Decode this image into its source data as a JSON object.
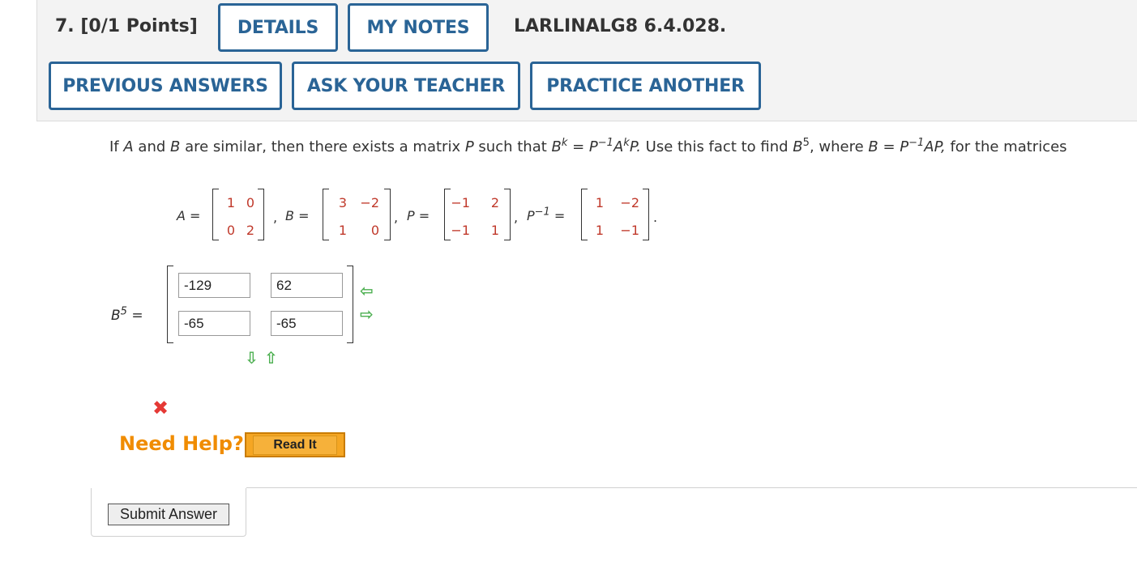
{
  "header": {
    "question_number": "7.",
    "points": "[0/1 Points]",
    "details_label": "DETAILS",
    "my_notes_label": "MY NOTES",
    "question_code": "LARLINALG8 6.4.028.",
    "previous_answers_label": "PREVIOUS ANSWERS",
    "ask_teacher_label": "ASK YOUR TEACHER",
    "practice_another_label": "PRACTICE ANOTHER"
  },
  "question": {
    "t1": "If ",
    "A": "A",
    "t2": " and ",
    "B": "B",
    "t3": " are similar, then there exists a matrix ",
    "P": "P",
    "t4": " such that ",
    "eq1": "B",
    "eq1_sup": "k",
    "eq1_rest": " = P",
    "eq1_sup2": "−1",
    "eq1_rest2": "A",
    "eq1_sup3": "k",
    "eq1_rest3": "P.",
    "t5": " Use this fact to find ",
    "b5": "B",
    "b5_sup": "5",
    "t6": ", where ",
    "eq2": "B = P",
    "eq2_sup": "−1",
    "eq2_rest": "AP,",
    "t7": " for the matrices"
  },
  "matrices": {
    "A_label": "A =",
    "A": [
      "1",
      "0",
      "0",
      "2"
    ],
    "B_label": "B =",
    "B": [
      "3",
      "−2",
      "1",
      "0"
    ],
    "P_label": "P =",
    "P": [
      "−1",
      "2",
      "−1",
      "1"
    ],
    "Pinv_label": "P",
    "Pinv_sup": "−1",
    "Pinv_eq": "=",
    "Pinv": [
      "1",
      "−2",
      "1",
      "−1"
    ],
    "comma": ",",
    "period": "."
  },
  "answer": {
    "label": "B",
    "label_sup": "5",
    "eq": "=",
    "values": [
      "-129",
      "62",
      "-65",
      "-65"
    ]
  },
  "status_icon": "incorrect-x-icon",
  "help": {
    "need_help_label": "Need Help?",
    "read_it_label": "Read It"
  },
  "submit_label": "Submit Answer",
  "colors": {
    "button_border": "#2a6496",
    "matrix_entries": "#c0392b",
    "arrows": "#4caf50",
    "incorrect": "#e53935",
    "need_help": "#f08c00",
    "read_it_bg": "#f5a623"
  }
}
